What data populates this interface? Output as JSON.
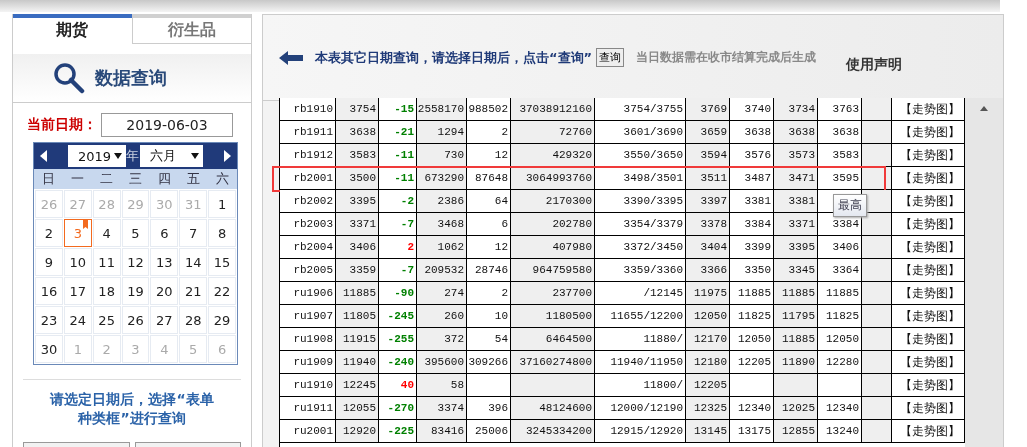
{
  "sidebar": {
    "tabs": [
      {
        "label": "期货",
        "selected": true
      },
      {
        "label": "衍生品",
        "selected": false
      }
    ],
    "section_title": "数据查询",
    "current_date": {
      "label": "当前日期：",
      "value": "2019-06-03"
    },
    "calendar": {
      "year": "2019",
      "year_label": "年",
      "month": "六月",
      "weekdays": [
        "日",
        "一",
        "二",
        "三",
        "四",
        "五",
        "六"
      ],
      "weeks": [
        [
          {
            "day": "26",
            "muted": true,
            "selected": false
          },
          {
            "day": "27",
            "muted": true,
            "selected": false
          },
          {
            "day": "28",
            "muted": true,
            "selected": false
          },
          {
            "day": "29",
            "muted": true,
            "selected": false
          },
          {
            "day": "30",
            "muted": true,
            "selected": false
          },
          {
            "day": "31",
            "muted": true,
            "selected": false
          },
          {
            "day": "1",
            "muted": false,
            "selected": false
          }
        ],
        [
          {
            "day": "2",
            "muted": false,
            "selected": false
          },
          {
            "day": "3",
            "muted": false,
            "selected": true
          },
          {
            "day": "4",
            "muted": false,
            "selected": false
          },
          {
            "day": "5",
            "muted": false,
            "selected": false
          },
          {
            "day": "6",
            "muted": false,
            "selected": false
          },
          {
            "day": "7",
            "muted": false,
            "selected": false
          },
          {
            "day": "8",
            "muted": false,
            "selected": false
          }
        ],
        [
          {
            "day": "9",
            "muted": false,
            "selected": false
          },
          {
            "day": "10",
            "muted": false,
            "selected": false
          },
          {
            "day": "11",
            "muted": false,
            "selected": false
          },
          {
            "day": "12",
            "muted": false,
            "selected": false
          },
          {
            "day": "13",
            "muted": false,
            "selected": false
          },
          {
            "day": "14",
            "muted": false,
            "selected": false
          },
          {
            "day": "15",
            "muted": false,
            "selected": false
          }
        ],
        [
          {
            "day": "16",
            "muted": false,
            "selected": false
          },
          {
            "day": "17",
            "muted": false,
            "selected": false
          },
          {
            "day": "18",
            "muted": false,
            "selected": false
          },
          {
            "day": "19",
            "muted": false,
            "selected": false
          },
          {
            "day": "20",
            "muted": false,
            "selected": false
          },
          {
            "day": "21",
            "muted": false,
            "selected": false
          },
          {
            "day": "22",
            "muted": false,
            "selected": false
          }
        ],
        [
          {
            "day": "23",
            "muted": false,
            "selected": false
          },
          {
            "day": "24",
            "muted": false,
            "selected": false
          },
          {
            "day": "25",
            "muted": false,
            "selected": false
          },
          {
            "day": "26",
            "muted": false,
            "selected": false
          },
          {
            "day": "27",
            "muted": false,
            "selected": false
          },
          {
            "day": "28",
            "muted": false,
            "selected": false
          },
          {
            "day": "29",
            "muted": false,
            "selected": false
          }
        ],
        [
          {
            "day": "30",
            "muted": false,
            "selected": false
          },
          {
            "day": "1",
            "muted": true,
            "selected": false
          },
          {
            "day": "2",
            "muted": true,
            "selected": false
          },
          {
            "day": "3",
            "muted": true,
            "selected": false
          },
          {
            "day": "4",
            "muted": true,
            "selected": false
          },
          {
            "day": "5",
            "muted": true,
            "selected": false
          },
          {
            "day": "6",
            "muted": true,
            "selected": false
          }
        ]
      ]
    },
    "instruction": "请选定日期后，选择“表单种类框”进行查询"
  },
  "header": {
    "notice": "本表其它日期查询，请选择日期后，点击“查询”",
    "query_button": "查询",
    "hint": "当日数据需在收市结算完成后生成",
    "disclaimer": "使用声明"
  },
  "table": {
    "rows": [
      {
        "code": "rb1910",
        "color": "#008000",
        "highlighted": false,
        "cells": [
          "3754",
          "-15",
          "2558170",
          "988502",
          "37038912160",
          "3754/3755",
          "3769",
          "3740",
          "3734",
          "3763",
          null
        ],
        "link": "【走势图】"
      },
      {
        "code": "rb1911",
        "color": "#008000",
        "highlighted": false,
        "cells": [
          "3638",
          "-21",
          "1294",
          "2",
          "72760",
          "3601/3690",
          "3659",
          "3638",
          "3638",
          "3638",
          null
        ],
        "link": "【走势图】"
      },
      {
        "code": "rb1912",
        "color": "#008000",
        "highlighted": false,
        "cells": [
          "3583",
          "-11",
          "730",
          "12",
          "429320",
          "3550/3650",
          "3594",
          "3576",
          "3573",
          "3583",
          null
        ],
        "link": "【走势图】"
      },
      {
        "code": "rb2001",
        "color": "#008000",
        "highlighted": true,
        "cells": [
          "3500",
          "-11",
          "673290",
          "87648",
          "3064993760",
          "3498/3501",
          "3511",
          "3487",
          "3471",
          "3595",
          null
        ],
        "link": "【走势图】"
      },
      {
        "code": "rb2002",
        "color": "#008000",
        "highlighted": false,
        "cells": [
          "3395",
          "-2",
          "2386",
          "64",
          "2170300",
          "3390/3395",
          "3397",
          "3381",
          "3381",
          null,
          null
        ],
        "link": "【走势图】"
      },
      {
        "code": "rb2003",
        "color": "#008000",
        "highlighted": false,
        "cells": [
          "3371",
          "-7",
          "3468",
          "6",
          "202780",
          "3354/3379",
          "3378",
          "3384",
          "3371",
          "3384",
          null
        ],
        "link": "【走势图】"
      },
      {
        "code": "rb2004",
        "color": "#ff0000",
        "highlighted": false,
        "cells": [
          "3406",
          "2",
          "1062",
          "12",
          "407980",
          "3372/3450",
          "3404",
          "3399",
          "3395",
          "3406",
          null
        ],
        "link": "【走势图】"
      },
      {
        "code": "rb2005",
        "color": "#008000",
        "highlighted": false,
        "cells": [
          "3359",
          "-7",
          "209532",
          "28746",
          "964759580",
          "3359/3360",
          "3366",
          "3350",
          "3345",
          "3364",
          null
        ],
        "link": "【走势图】"
      },
      {
        "code": "ru1906",
        "color": "#008000",
        "highlighted": false,
        "cells": [
          "11885",
          "-90",
          "274",
          "2",
          "237700",
          "/12145",
          "11975",
          "11885",
          "11885",
          "11885",
          null
        ],
        "link": "【走势图】"
      },
      {
        "code": "ru1907",
        "color": "#008000",
        "highlighted": false,
        "cells": [
          "11805",
          "-245",
          "260",
          "10",
          "1180500",
          "11655/12200",
          "12050",
          "11825",
          "11795",
          "11825",
          null
        ],
        "link": "【走势图】"
      },
      {
        "code": "ru1908",
        "color": "#008000",
        "highlighted": false,
        "cells": [
          "11915",
          "-255",
          "372",
          "54",
          "6464500",
          "11880/",
          "12170",
          "12050",
          "11885",
          "12050",
          null
        ],
        "link": "【走势图】"
      },
      {
        "code": "ru1909",
        "color": "#008000",
        "highlighted": false,
        "cells": [
          "11940",
          "-240",
          "395600",
          "309266",
          "37160274800",
          "11940/11950",
          "12180",
          "12205",
          "11890",
          "12280",
          null
        ],
        "link": "【走势图】"
      },
      {
        "code": "ru1910",
        "color": "#ff0000",
        "highlighted": false,
        "cells": [
          "12245",
          "40",
          "58",
          null,
          null,
          "11800/",
          "12205",
          null,
          null,
          null,
          null
        ],
        "link": "【走势图】"
      },
      {
        "code": "ru1911",
        "color": "#008000",
        "highlighted": false,
        "cells": [
          "12055",
          "-270",
          "3374",
          "396",
          "48124600",
          "12000/12190",
          "12325",
          "12340",
          "12025",
          "12340",
          null
        ],
        "link": "【走势图】"
      },
      {
        "code": "ru2001",
        "color": "#008000",
        "highlighted": false,
        "cells": [
          "12920",
          "-225",
          "83416",
          "25006",
          "3245334200",
          "12915/12920",
          "13145",
          "13175",
          "12855",
          "13240",
          null
        ],
        "link": "【走势图】"
      }
    ],
    "tooltip": {
      "text": "最高"
    }
  }
}
